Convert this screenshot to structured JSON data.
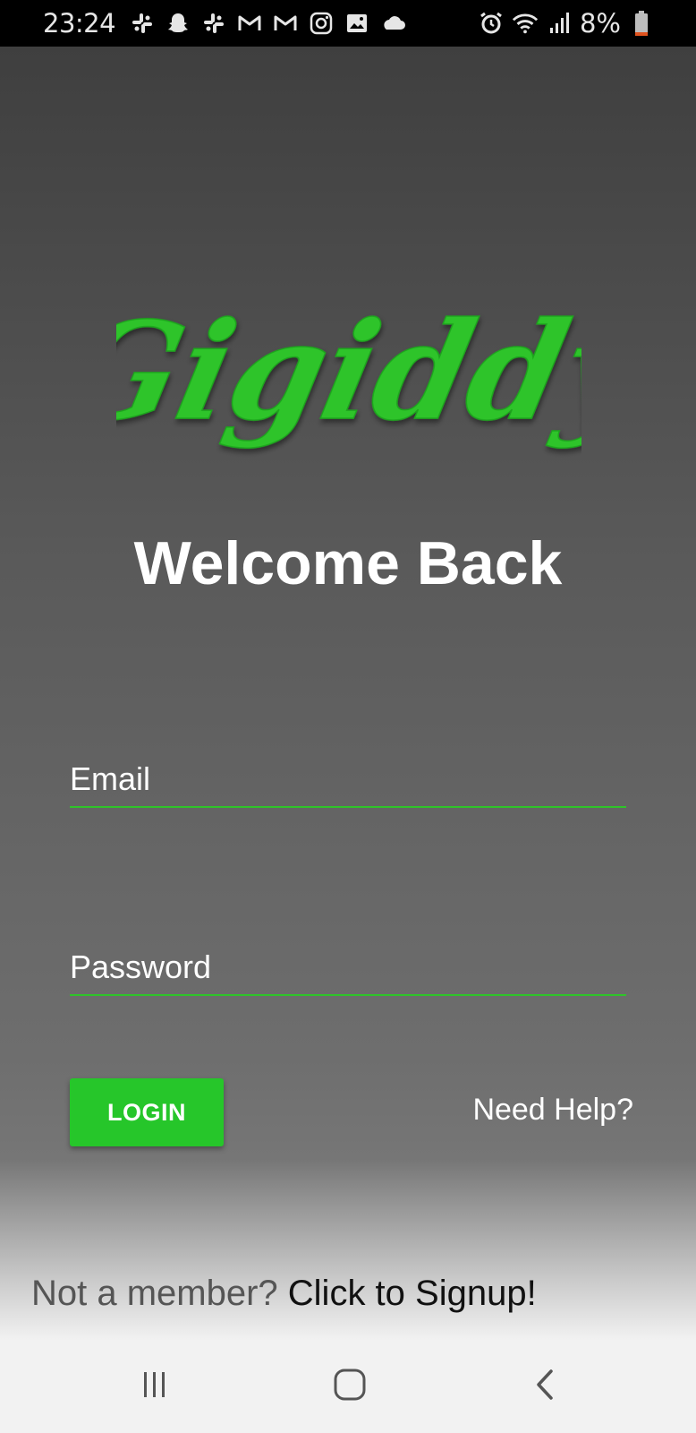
{
  "status_bar": {
    "time": "23:24",
    "battery": "8%",
    "left_icons": [
      "slack-icon",
      "snapchat-icon",
      "slack-icon",
      "gmail-icon",
      "gmail-icon",
      "instagram-icon",
      "gallery-icon",
      "cloud-icon"
    ],
    "right_icons": [
      "alarm-icon",
      "wifi-icon",
      "signal-icon",
      "battery-icon"
    ]
  },
  "app": {
    "logo_text": "Gigiddy",
    "heading": "Welcome Back",
    "email": {
      "placeholder": "Email",
      "value": ""
    },
    "password": {
      "placeholder": "Password",
      "value": ""
    },
    "login_label": "LOGIN",
    "need_help": "Need Help?",
    "signup_prompt": "Not a member? ",
    "signup_link": "Click to Signup!"
  },
  "colors": {
    "accent": "#26c62a",
    "field_underline": "#2fc42a",
    "background_top": "#3f3f3f",
    "background_bottom": "#767676",
    "nav_bar": "#f2f2f2"
  },
  "nav_bar": {
    "buttons": [
      "recents-icon",
      "home-icon",
      "back-icon"
    ]
  }
}
